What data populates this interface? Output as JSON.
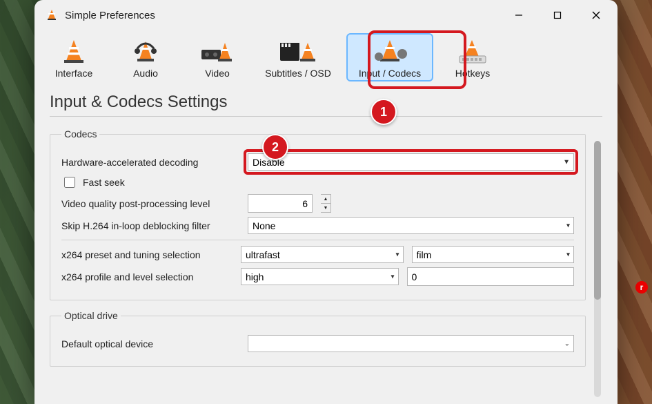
{
  "window": {
    "title": "Simple Preferences"
  },
  "cats": [
    {
      "label": "Interface"
    },
    {
      "label": "Audio"
    },
    {
      "label": "Video"
    },
    {
      "label": "Subtitles / OSD"
    },
    {
      "label": "Input / Codecs"
    },
    {
      "label": "Hotkeys"
    }
  ],
  "section_title": "Input & Codecs Settings",
  "codecs": {
    "legend": "Codecs",
    "hw_label": "Hardware-accelerated decoding",
    "hw_value": "Disable",
    "fast_seek_label": "Fast seek",
    "vq_label": "Video quality post-processing level",
    "vq_value": "6",
    "skip_label": "Skip H.264 in-loop deblocking filter",
    "skip_value": "None",
    "preset_label": "x264 preset and tuning selection",
    "preset_value": "ultrafast",
    "tuning_value": "film",
    "profile_label": "x264 profile and level selection",
    "profile_value": "high",
    "level_value": "0"
  },
  "optical": {
    "legend": "Optical drive",
    "default_label": "Default optical device",
    "default_value": ""
  },
  "annotations": {
    "badge1": "1",
    "badge2": "2"
  }
}
